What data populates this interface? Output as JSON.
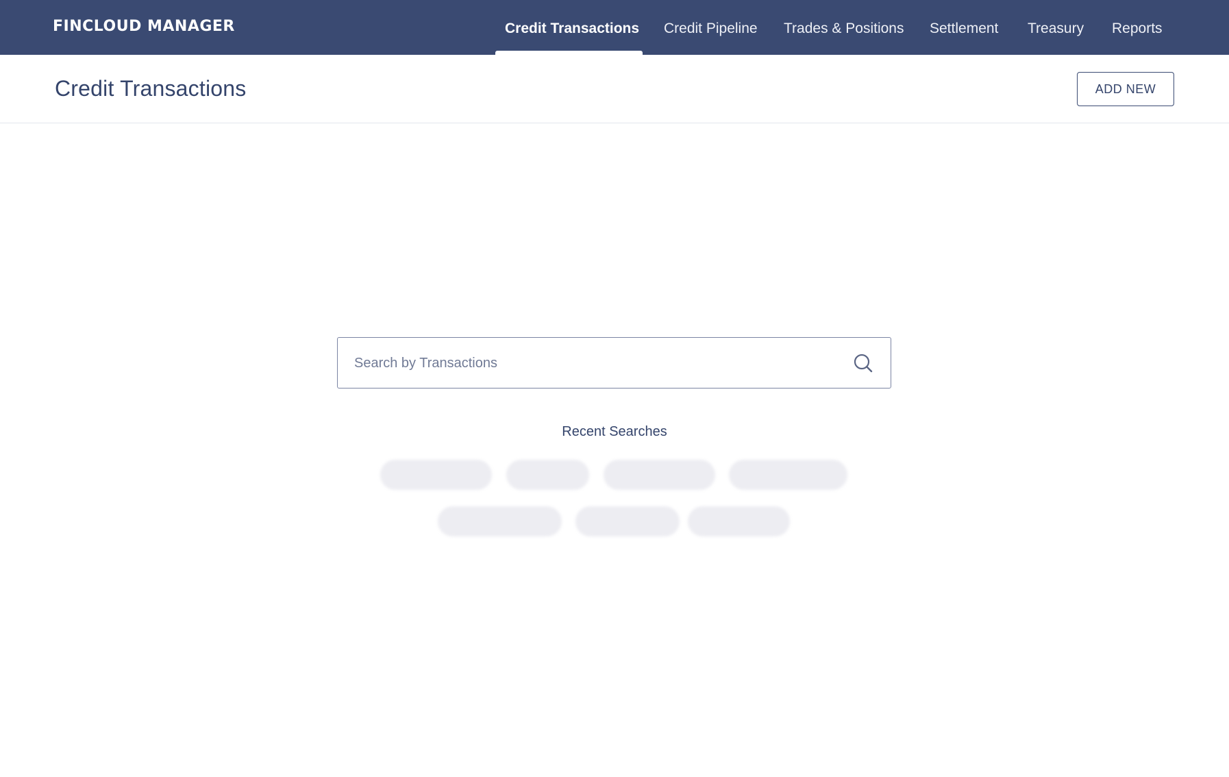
{
  "app": {
    "brand": "FINCLOUD MANAGER"
  },
  "nav": {
    "items": [
      {
        "label": "Credit Transactions",
        "active": true
      },
      {
        "label": "Credit Pipeline",
        "active": false
      },
      {
        "label": "Trades & Positions",
        "active": false
      },
      {
        "label": "Settlement",
        "active": false
      },
      {
        "label": "Treasury",
        "active": false
      },
      {
        "label": "Reports",
        "active": false
      }
    ]
  },
  "header": {
    "title": "Credit Transactions",
    "add_button_label": "ADD NEW"
  },
  "search": {
    "placeholder": "Search by Transactions",
    "value": "",
    "icon": "search-icon"
  },
  "recent": {
    "title": "Recent Searches",
    "chips": []
  },
  "colors": {
    "nav_bg": "#3a4a72",
    "primary_text": "#34446b",
    "chip_bg": "#ededf2"
  }
}
